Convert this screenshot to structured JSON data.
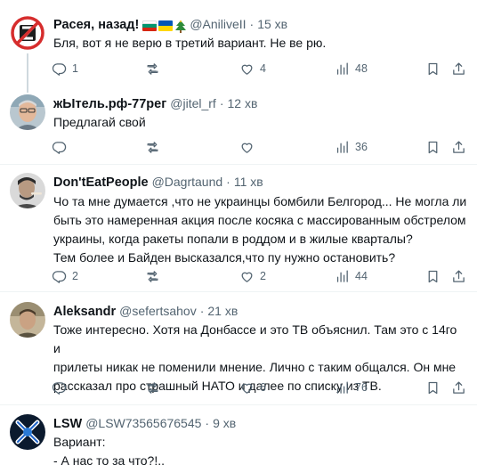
{
  "tweets": [
    {
      "display_name": "Расея, назад!",
      "handle": "@AniliveII",
      "dot": "·",
      "time": "15 хв",
      "text": "Бля, вот я не верю в третий вариант. Не ве рю.",
      "replies": "1",
      "retweets": "",
      "likes": "4",
      "views": "48"
    },
    {
      "display_name": "жЫтель.рф-77рег",
      "handle": "@jitel_rf",
      "dot": "·",
      "time": "12 хв",
      "text": "Предлагай свой",
      "replies": "",
      "retweets": "",
      "likes": "",
      "views": "36"
    },
    {
      "display_name": "Don'tEatPeople",
      "handle": "@Dagrtaund",
      "dot": "·",
      "time": "11 хв",
      "text": "Чо та мне думается ,что не украинцы бомбили Белгород... Не могла ли\nбыть это намеренная акция после косяка с массированным обстрелом\nукраины, когда ракеты попали в роддом и в жилые кварталы?\nТем более и Байден высказался,что пу нужно остановить?",
      "replies": "2",
      "retweets": "",
      "likes": "2",
      "views": "44"
    },
    {
      "display_name": "Aleksandr",
      "handle": "@sefertsahov",
      "dot": "·",
      "time": "21 хв",
      "text": "Тоже интересно. Хотя на Донбассе и это ТВ объяснил. Там это с 14го и\nприлеты никак не поменили мнение. Лично с таким общался. Он мне\nрассказал про страшный НАТО и далее по списку из ТВ.",
      "replies": "",
      "retweets": "",
      "likes": "6",
      "views": "76"
    },
    {
      "display_name": "LSW",
      "handle": "@LSW73565676545",
      "dot": "·",
      "time": "9 хв",
      "text": "Вариант:\n- А нас то за что?!..",
      "replies": "",
      "retweets": "",
      "likes": "",
      "views": ""
    }
  ],
  "icons": {
    "reply": "reply-icon",
    "retweet": "retweet-icon",
    "like": "heart-icon",
    "views": "views-icon",
    "bookmark": "bookmark-icon",
    "share": "share-icon"
  },
  "colors": {
    "text_primary": "#0f1419",
    "text_secondary": "#536471",
    "divider": "#eff3f4",
    "thread_line": "#cfd9de"
  }
}
